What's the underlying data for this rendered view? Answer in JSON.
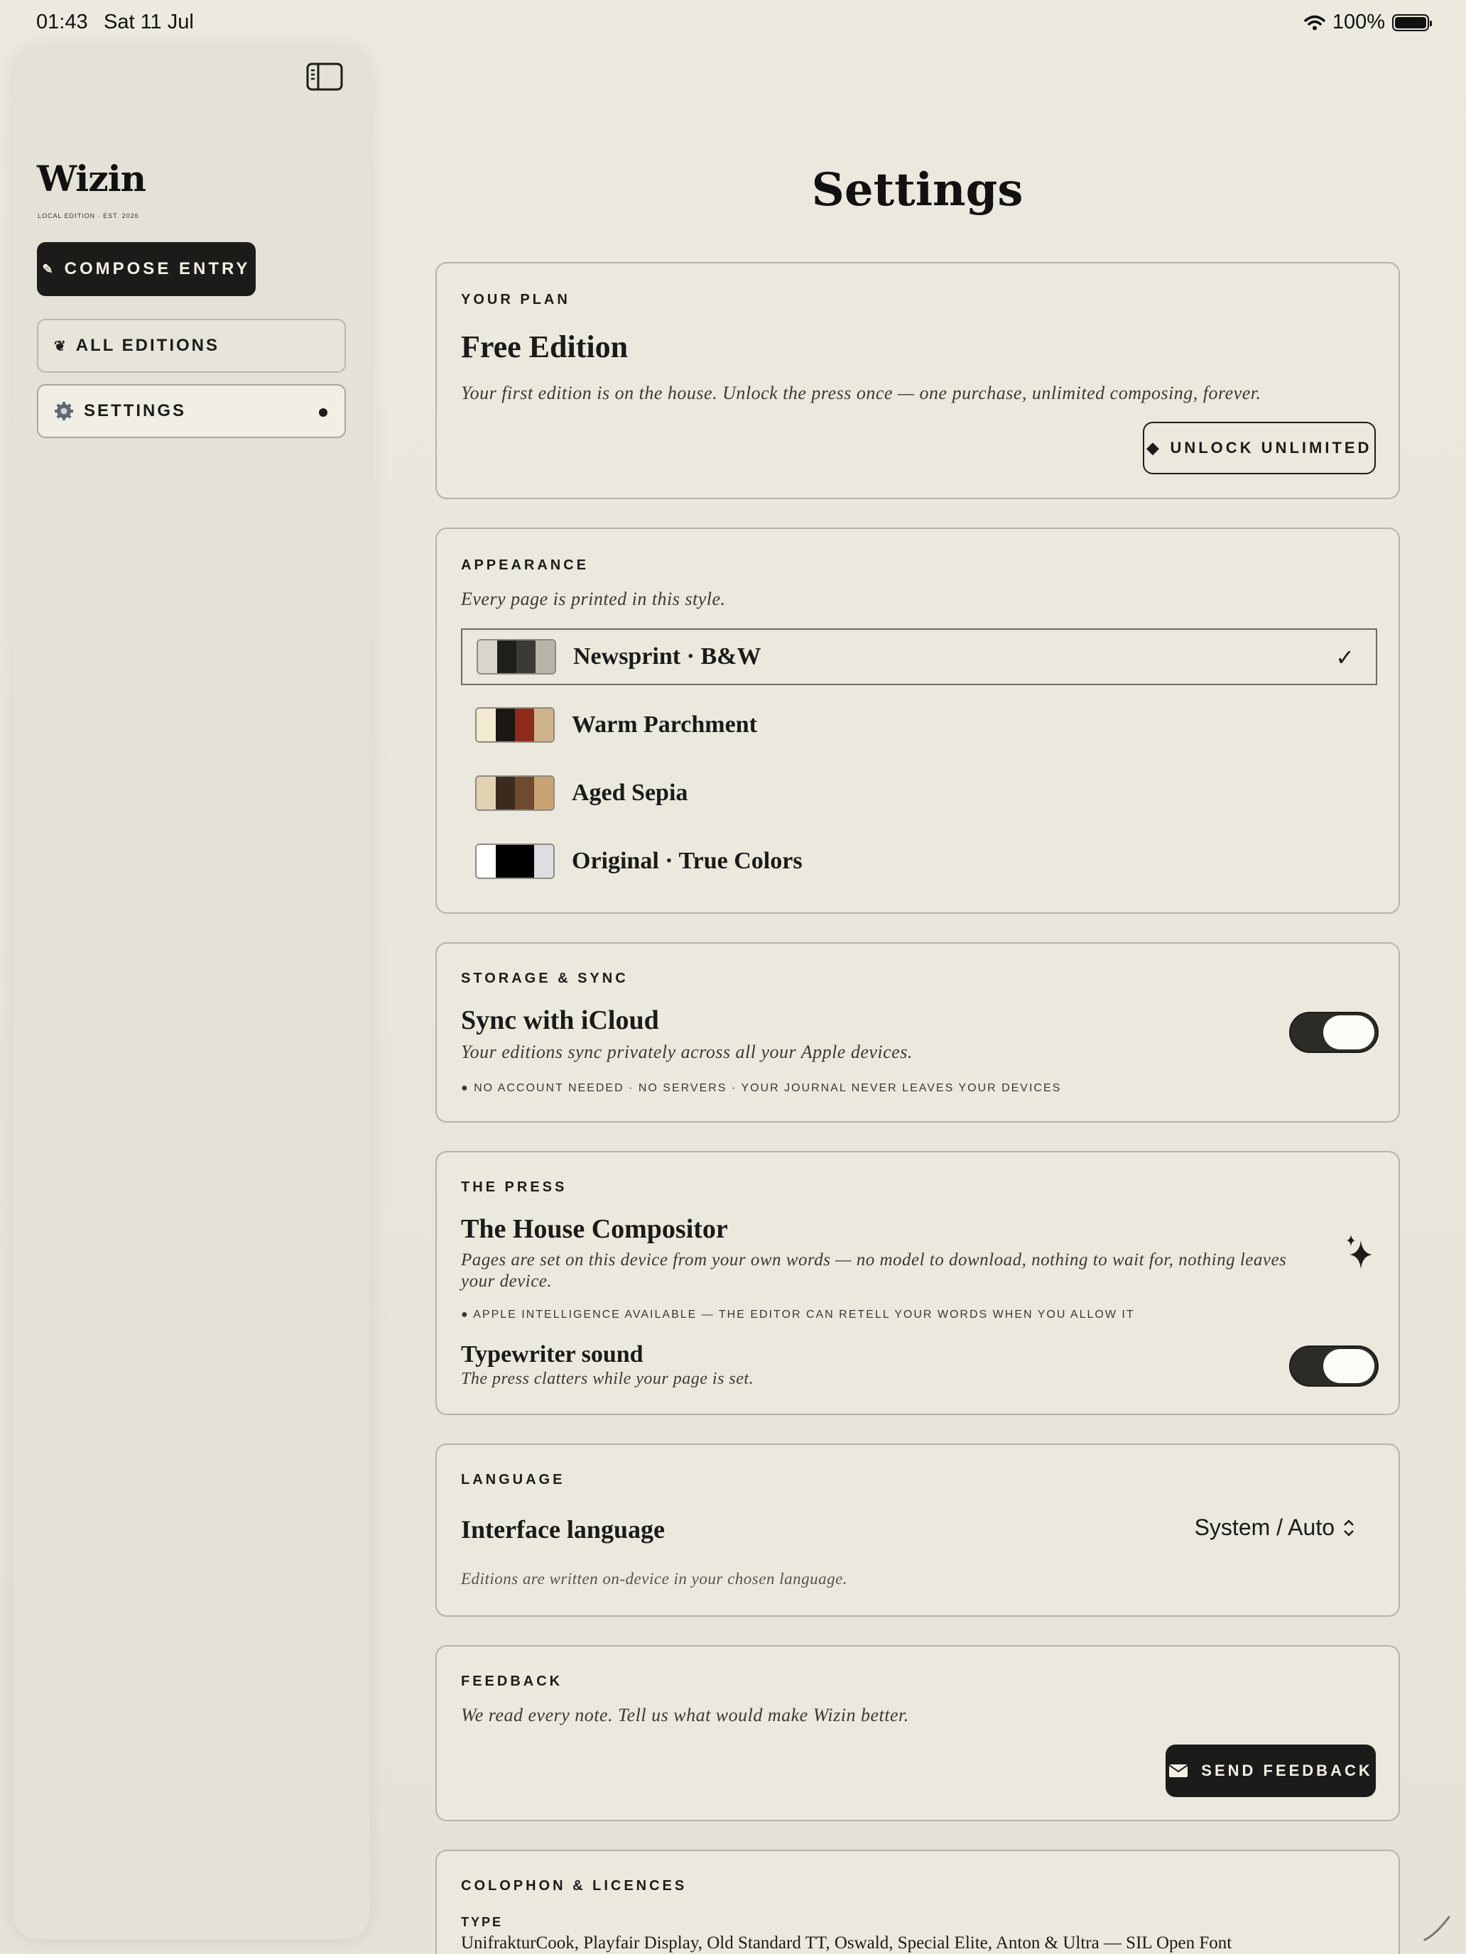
{
  "status_bar": {
    "time": "01:43",
    "date": "Sat 11 Jul",
    "battery": "100%"
  },
  "sidebar": {
    "logo": "Wizin",
    "logo_subtitle": "LOCAL EDITION · EST. 2026",
    "compose_label": "COMPOSE ENTRY",
    "items": [
      {
        "label": "ALL EDITIONS",
        "icon": "emblem-icon"
      },
      {
        "label": "SETTINGS",
        "icon": "gear-icon",
        "active": true
      }
    ]
  },
  "page_title": "Settings",
  "plan": {
    "label": "YOUR PLAN",
    "title": "Free Edition",
    "description": "Your first edition is on the house. Unlock the press once — one purchase, unlimited composing, forever.",
    "button": "UNLOCK UNLIMITED"
  },
  "appearance": {
    "label": "APPEARANCE",
    "subtitle": "Every page is printed in this style.",
    "themes": [
      {
        "name": "Newsprint · B&W",
        "colors": [
          "#d8d5cc",
          "#1e1e1c",
          "#3a3a37",
          "#b6b3aa"
        ],
        "selected": true
      },
      {
        "name": "Warm Parchment",
        "colors": [
          "#f3ead2",
          "#1b1714",
          "#8e2a1c",
          "#cdb28a"
        ]
      },
      {
        "name": "Aged Sepia",
        "colors": [
          "#e3d2b2",
          "#3b2a1e",
          "#6f4a2e",
          "#c9a274"
        ]
      },
      {
        "name": "Original · True Colors",
        "colors": [
          "#ffffff",
          "#000000",
          "#000000",
          "#dddde2"
        ]
      }
    ]
  },
  "storage": {
    "label": "STORAGE & SYNC",
    "title": "Sync with iCloud",
    "description": "Your editions sync privately across all your Apple devices.",
    "note": "● NO ACCOUNT NEEDED · NO SERVERS · YOUR JOURNAL NEVER LEAVES YOUR DEVICES",
    "toggle_on": true
  },
  "press": {
    "label": "THE PRESS",
    "title": "The House Compositor",
    "description_line1": "Pages are set on this device from your own words — no model to download, nothing to wait for, nothing leaves",
    "description_line2": "your device.",
    "note": "● APPLE INTELLIGENCE AVAILABLE — THE EDITOR CAN RETELL YOUR WORDS WHEN YOU ALLOW IT",
    "typewriter_title": "Typewriter sound",
    "typewriter_desc": "The press clatters while your page is set.",
    "toggle_on": true
  },
  "language": {
    "label": "LANGUAGE",
    "title": "Interface language",
    "value": "System / Auto",
    "description": "Editions are written on-device in your chosen language."
  },
  "feedback": {
    "label": "FEEDBACK",
    "description": "We read every note. Tell us what would make Wizin better.",
    "button": "SEND FEEDBACK"
  },
  "colophon": {
    "label": "COLOPHON & LICENCES",
    "type_label": "TYPE",
    "type_value": "UnifrakturCook, Playfair Display, Old Standard TT, Oswald, Special Elite, Anton & Ultra — SIL Open Font"
  }
}
